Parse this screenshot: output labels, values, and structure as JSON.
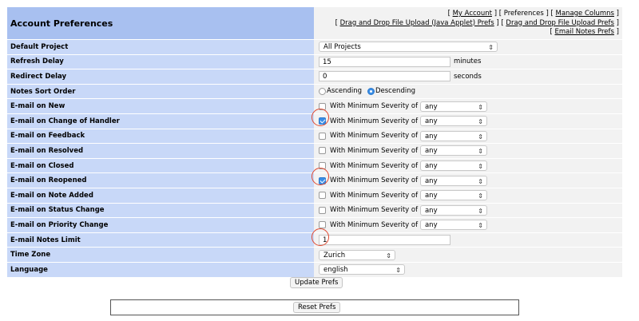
{
  "header": {
    "title": "Account Preferences",
    "links": {
      "bracket_open": "[",
      "bracket_close": "]",
      "my_account": "My Account",
      "preferences": "Preferences",
      "manage_columns": "Manage Columns",
      "dnd_java": "Drag and Drop File Upload (Java Applet) Prefs",
      "dnd": "Drag and Drop File Upload Prefs",
      "email_notes": "Email Notes Prefs"
    }
  },
  "rows": {
    "default_project": {
      "label": "Default Project",
      "value": "All Projects"
    },
    "refresh_delay": {
      "label": "Refresh Delay",
      "value": "15",
      "unit": "minutes"
    },
    "redirect_delay": {
      "label": "Redirect Delay",
      "value": "0",
      "unit": "seconds"
    },
    "notes_sort_order": {
      "label": "Notes Sort Order",
      "options": [
        "Ascending",
        "Descending"
      ],
      "selected": "Descending"
    },
    "email": [
      {
        "label": "E-mail on New",
        "checked": false,
        "severity_label": "With Minimum Severity of",
        "severity": "any"
      },
      {
        "label": "E-mail on Change of Handler",
        "checked": true,
        "severity_label": "With Minimum Severity of",
        "severity": "any"
      },
      {
        "label": "E-mail on Feedback",
        "checked": false,
        "severity_label": "With Minimum Severity of",
        "severity": "any"
      },
      {
        "label": "E-mail on Resolved",
        "checked": false,
        "severity_label": "With Minimum Severity of",
        "severity": "any"
      },
      {
        "label": "E-mail on Closed",
        "checked": false,
        "severity_label": "With Minimum Severity of",
        "severity": "any"
      },
      {
        "label": "E-mail on Reopened",
        "checked": true,
        "severity_label": "With Minimum Severity of",
        "severity": "any"
      },
      {
        "label": "E-mail on Note Added",
        "checked": false,
        "severity_label": "With Minimum Severity of",
        "severity": "any"
      },
      {
        "label": "E-mail on Status Change",
        "checked": false,
        "severity_label": "With Minimum Severity of",
        "severity": "any"
      },
      {
        "label": "E-mail on Priority Change",
        "checked": false,
        "severity_label": "With Minimum Severity of",
        "severity": "any"
      }
    ],
    "email_notes_limit": {
      "label": "E-mail Notes Limit",
      "value": "1"
    },
    "time_zone": {
      "label": "Time Zone",
      "value": "Zurich"
    },
    "language": {
      "label": "Language",
      "value": "english"
    }
  },
  "buttons": {
    "update": "Update Prefs",
    "reset": "Reset Prefs"
  },
  "icons": {
    "select_arrow": "updown-chevron-icon"
  },
  "colors": {
    "header_bg": "#a8c0f0",
    "label_bg": "#c8d8f8",
    "value_bg": "#f2f2f2",
    "highlight_circle": "#e0482f",
    "checkbox_checked": "#3a8ee6"
  }
}
